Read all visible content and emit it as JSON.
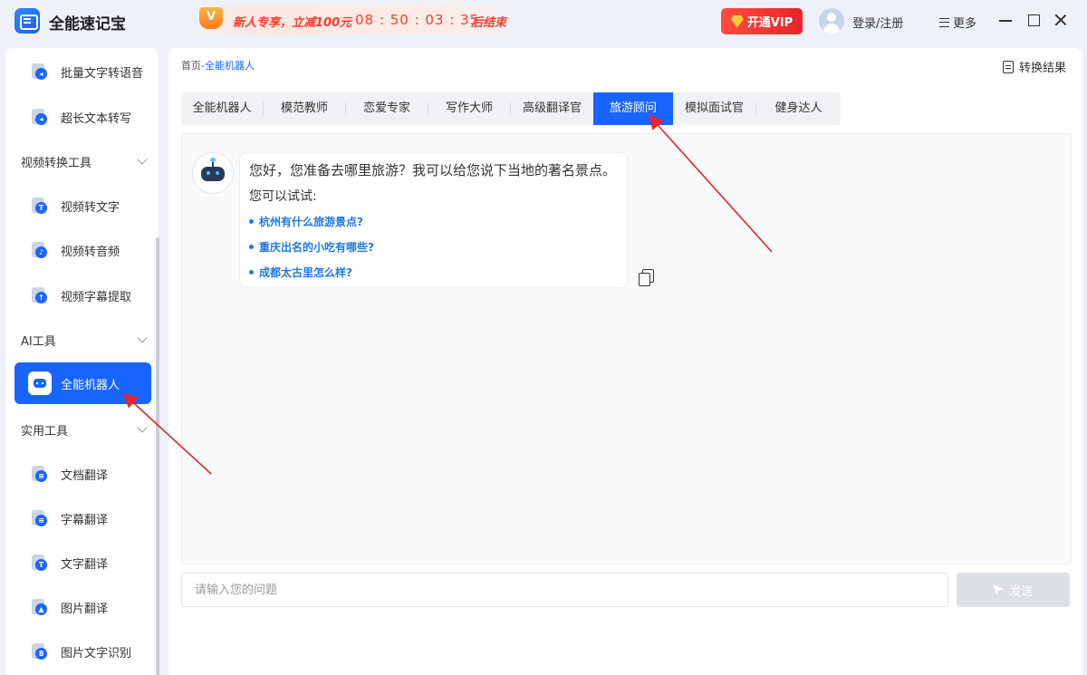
{
  "app": {
    "name": "全能速记宝"
  },
  "promo": {
    "badge": "V",
    "text": "新人专享，立减100元",
    "timer": "08 : 50 : 03 : 35",
    "end_text": "后结束"
  },
  "header": {
    "vip_label": "开通VIP",
    "login_label": "登录/注册",
    "more_label": "更多"
  },
  "sidebar": {
    "top_items": [
      {
        "label": "批量文字转语音"
      },
      {
        "label": "超长文本转写"
      }
    ],
    "sections": [
      {
        "title": "视频转换工具",
        "items": [
          {
            "label": "视频转文字",
            "glyph": "T"
          },
          {
            "label": "视频转音频",
            "glyph": "♪"
          },
          {
            "label": "视频字幕提取",
            "glyph": "↑"
          }
        ]
      },
      {
        "title": "AI工具",
        "items": [
          {
            "label": "全能机器人",
            "active": true
          }
        ]
      },
      {
        "title": "实用工具",
        "items": [
          {
            "label": "文档翻译",
            "glyph": "≡"
          },
          {
            "label": "字幕翻译",
            "glyph": "≡"
          },
          {
            "label": "文字翻译",
            "glyph": "T"
          },
          {
            "label": "图片翻译",
            "glyph": "▲"
          },
          {
            "label": "图片文字识别",
            "glyph": "8"
          }
        ]
      }
    ]
  },
  "breadcrumb": {
    "home": "首页",
    "sep": "-",
    "current": "全能机器人"
  },
  "convert_result_label": "转换结果",
  "tabs": [
    {
      "label": "全能机器人"
    },
    {
      "label": "模范教师"
    },
    {
      "label": "恋爱专家"
    },
    {
      "label": "写作大师"
    },
    {
      "label": "高级翻译官"
    },
    {
      "label": "旅游顾问",
      "active": true
    },
    {
      "label": "模拟面试官"
    },
    {
      "label": "健身达人"
    }
  ],
  "chat": {
    "greeting": "您好，您准备去哪里旅游？我可以给您说下当地的著名景点。",
    "try_label": "您可以试试:",
    "suggestions": [
      "杭州有什么旅游景点?",
      "重庆出名的小吃有哪些?",
      "成都太古里怎么样?"
    ]
  },
  "input": {
    "placeholder": "请输入您的问题",
    "value": ""
  },
  "send_label": "发送",
  "colors": {
    "accent": "#1764ff",
    "promo_red": "#ff3b30",
    "annotation_red": "#e8232b"
  }
}
